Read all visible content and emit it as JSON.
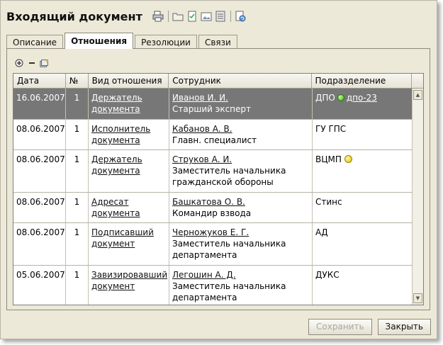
{
  "window": {
    "title": "Входящий документ"
  },
  "toolbar_icons": [
    "print-icon",
    "folder-icon",
    "document-check-icon",
    "image-icon",
    "list-icon",
    "refresh-icon"
  ],
  "tabs": [
    {
      "label": "Описание",
      "active": false
    },
    {
      "label": "Отношения",
      "active": true
    },
    {
      "label": "Резолюции",
      "active": false
    },
    {
      "label": "Связи",
      "active": false
    }
  ],
  "panel_toolbar_icons": [
    "add-icon",
    "remove-icon",
    "add-relation-icon"
  ],
  "grid": {
    "columns": [
      "Дата",
      "№",
      "Вид отношения",
      "Сотрудник",
      "Подразделение"
    ],
    "rows": [
      {
        "date": "16.06.2007",
        "num": "1",
        "relation": "Держатель документа",
        "employee_name": "Иванов И. И.",
        "employee_title": "Старший эксперт",
        "dept": "ДПО",
        "dept_link": "дпо-23",
        "dept_icon": "green",
        "selected": true
      },
      {
        "date": "08.06.2007",
        "num": "1",
        "relation": "Исполнитель документа",
        "employee_name": "Кабанов А. В.",
        "employee_title": "Главн. специалист",
        "dept": "ГУ ГПС",
        "dept_link": "",
        "dept_icon": "",
        "selected": false
      },
      {
        "date": "08.06.2007",
        "num": "1",
        "relation": "Держатель документа",
        "employee_name": "Струков А. И.",
        "employee_title": "Заместитель начальника гражданской обороны",
        "dept": "ВЦМП",
        "dept_link": "",
        "dept_icon": "yellow",
        "selected": false
      },
      {
        "date": "08.06.2007",
        "num": "1",
        "relation": "Адресат документа",
        "employee_name": "Башкатова О. В.",
        "employee_title": "Командир взвода",
        "dept": "Стинс",
        "dept_link": "",
        "dept_icon": "",
        "selected": false
      },
      {
        "date": "08.06.2007",
        "num": "1",
        "relation": "Подписавший документ",
        "employee_name": "Черножуков Е. Г.",
        "employee_title": "Заместитель начальника департамента",
        "dept": "АД",
        "dept_link": "",
        "dept_icon": "",
        "selected": false
      },
      {
        "date": "05.06.2007",
        "num": "1",
        "relation": "Завизировавший документ",
        "employee_name": "Легошин А. Д.",
        "employee_title": "Заместитель начальника департамента",
        "dept": "ДУКС",
        "dept_link": "",
        "dept_icon": "",
        "selected": false
      }
    ]
  },
  "buttons": {
    "save": "Сохранить",
    "close": "Закрыть"
  },
  "colors": {
    "selected_row": "#777777",
    "window_bg": "#ece9d8"
  }
}
